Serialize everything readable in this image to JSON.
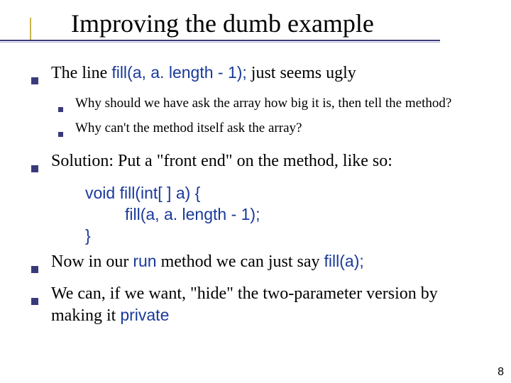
{
  "title": "Improving the dumb example",
  "page_number": "8",
  "b1": {
    "pre": "The line  ",
    "code": "fill(a, a. length - 1);",
    "post": "   just seems ugly",
    "sub1": "Why should we have ask the array how big it is, then tell the method?",
    "sub2": "Why can't the method itself ask the array?"
  },
  "b2": {
    "text": "Solution: Put a \"front end\" on the method, like so:",
    "code_l1": "void fill(int[ ] a) {",
    "code_l2": "fill(a, a. length - 1);",
    "code_l3": "}"
  },
  "b3": {
    "pre": "Now in our ",
    "code1": "run",
    "mid": " method we can just say  ",
    "code2": "fill(a);"
  },
  "b4": {
    "pre": "We can, if we want, \"hide\" the two-parameter version by making it ",
    "code": "private"
  }
}
